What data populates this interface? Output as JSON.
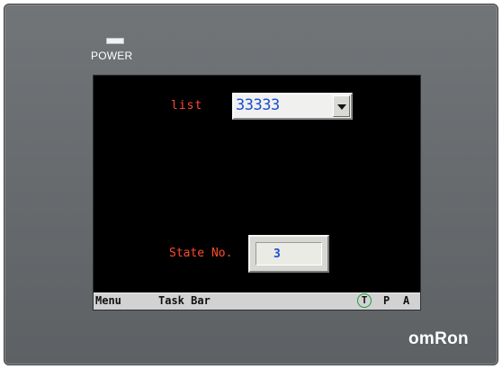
{
  "device": {
    "power_label": "POWER",
    "brand": "omRon",
    "bezel_color": "#65696c"
  },
  "screen": {
    "list": {
      "label": "list",
      "selected_value": "33333",
      "dropdown_icon": "triangle-down-icon"
    },
    "state": {
      "label": "State No.",
      "value": "3"
    },
    "label_color": "#ff4a2e",
    "value_color": "#1a4fd0"
  },
  "taskbar": {
    "menu": "Menu",
    "task_bar": "Task Bar",
    "t": "T",
    "p": "P",
    "a": "A",
    "t_ring_color": "#1e9a3a"
  }
}
